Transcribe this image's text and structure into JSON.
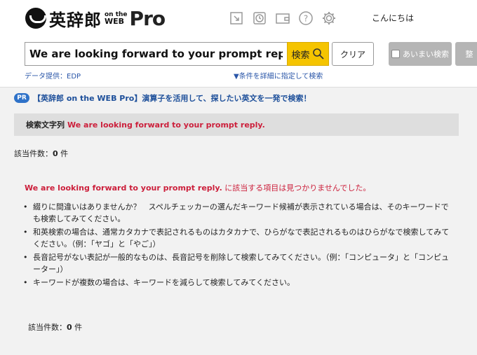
{
  "header": {
    "logo_main": "英辞郎",
    "logo_on_the": "on the",
    "logo_web": "WEB",
    "logo_pro": "Pro",
    "greeting": "こんにちは",
    "icons": [
      "screen-capture-icon",
      "history-icon",
      "wallet-icon",
      "help-icon",
      "settings-icon"
    ]
  },
  "search": {
    "value": "We are looking forward to your prompt reply.",
    "button_label": "検索",
    "clear_label": "クリア",
    "fuzzy_label": "あいまい検索",
    "extra_label": "整",
    "data_provider": "データ提供：EDP",
    "detail_link": "▼条件を詳細に指定して検索"
  },
  "promo": {
    "badge": "PR",
    "text": "【英辞郎 on the WEB Pro】演算子を活用して、探したい英文を一発で検索！"
  },
  "query_bar": {
    "label": "検索文字列",
    "value": "We are looking forward to your prompt reply."
  },
  "results": {
    "count_label": "該当件数：",
    "count_value": "0",
    "count_unit": "件",
    "not_found_query": "We are looking forward to your prompt reply.",
    "not_found_message": "に該当する項目は見つかりませんでした。",
    "tips": [
      "綴りに間違いはありませんか？　スペルチェッカーの選んだキーワード候補が表示されている場合は、そのキーワードでも検索してみてください。",
      "和英検索の場合は、通常カタカナで表記されるものはカタカナで、ひらがなで表記されるものはひらがなで検索してみてください。（例：「ヤゴ」と「やご」）",
      "長音記号がない表記が一般的なものは、長音記号を削除して検索してみてください。（例：「コンピュータ」と「コンピューター」）",
      "キーワードが複数の場合は、キーワードを減らして検索してみてください。"
    ]
  },
  "colors": {
    "accent_yellow": "#f5c400",
    "link_blue": "#1d4f9a",
    "error_red": "#cc1f3b",
    "pr_blue": "#2f72c8"
  }
}
